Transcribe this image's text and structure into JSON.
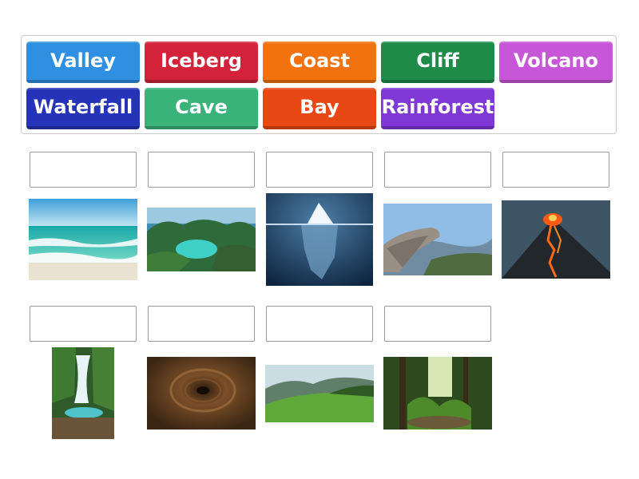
{
  "word_bank": {
    "tiles": [
      {
        "label": "Valley",
        "color": "#2f8fe0"
      },
      {
        "label": "Iceberg",
        "color": "#d3233a"
      },
      {
        "label": "Coast",
        "color": "#f2720f"
      },
      {
        "label": "Cliff",
        "color": "#1e8c48"
      },
      {
        "label": "Volcano",
        "color": "#c856d8"
      },
      {
        "label": "Waterfall",
        "color": "#2533b8"
      },
      {
        "label": "Cave",
        "color": "#3ab37b"
      },
      {
        "label": "Bay",
        "color": "#e74814"
      },
      {
        "label": "Rainforest",
        "color": "#7f38d6"
      }
    ]
  },
  "images": [
    {
      "icon": "beach-photo"
    },
    {
      "icon": "tropical-bay-photo"
    },
    {
      "icon": "iceberg-photo"
    },
    {
      "icon": "rock-cliff-photo"
    },
    {
      "icon": "erupting-volcano-photo"
    },
    {
      "icon": "waterfall-photo"
    },
    {
      "icon": "cave-tunnel-photo"
    },
    {
      "icon": "green-valley-photo"
    },
    {
      "icon": "rainforest-photo"
    }
  ]
}
